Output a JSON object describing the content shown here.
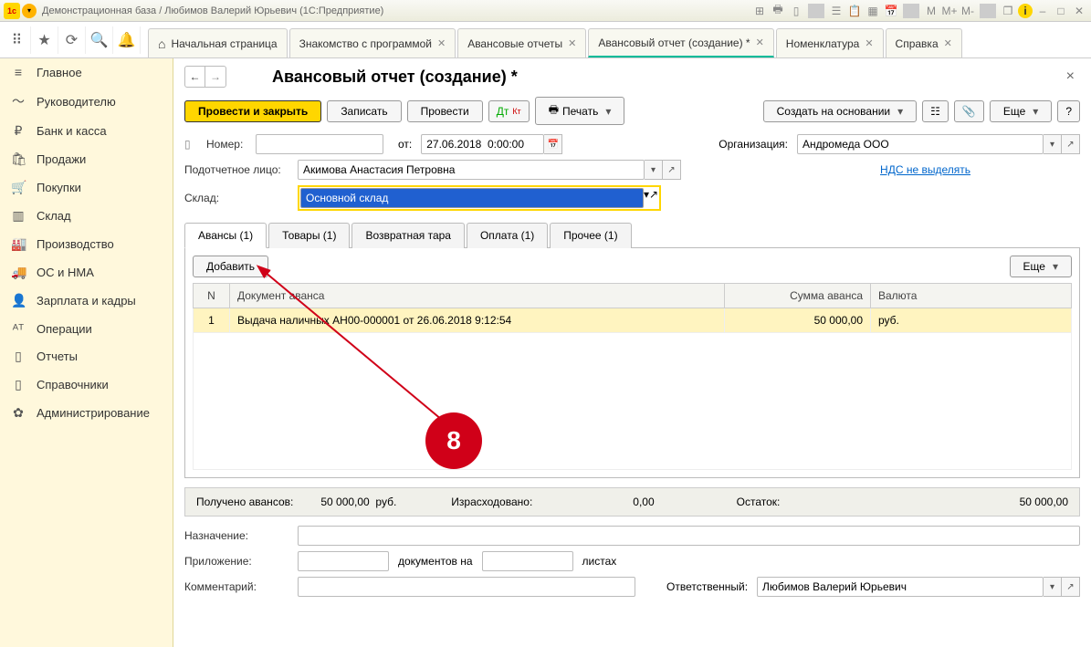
{
  "titlebar": {
    "title": "Демонстрационная база / Любимов Валерий Юрьевич  (1С:Предприятие)"
  },
  "tabs": {
    "home": "Начальная страница",
    "t1": "Знакомство с программой",
    "t2": "Авансовые отчеты",
    "t3": "Авансовый отчет (создание) *",
    "t4": "Номенклатура",
    "t5": "Справка"
  },
  "sidebar": {
    "items": [
      {
        "icon": "≡",
        "label": "Главное"
      },
      {
        "icon": "〜",
        "label": "Руководителю"
      },
      {
        "icon": "₽",
        "label": "Банк и касса"
      },
      {
        "icon": "🛍",
        "label": "Продажи"
      },
      {
        "icon": "🛒",
        "label": "Покупки"
      },
      {
        "icon": "▥",
        "label": "Склад"
      },
      {
        "icon": "🏭",
        "label": "Производство"
      },
      {
        "icon": "🚚",
        "label": "ОС и НМА"
      },
      {
        "icon": "👤",
        "label": "Зарплата и кадры"
      },
      {
        "icon": "ᴬᵀ",
        "label": "Операции"
      },
      {
        "icon": "▯",
        "label": "Отчеты"
      },
      {
        "icon": "▯",
        "label": "Справочники"
      },
      {
        "icon": "✿",
        "label": "Администрирование"
      }
    ]
  },
  "page": {
    "title": "Авансовый отчет (создание) *",
    "buttons": {
      "post_close": "Провести и закрыть",
      "save": "Записать",
      "post": "Провести",
      "print": "Печать",
      "create_based": "Создать на основании",
      "more": "Еще"
    },
    "form": {
      "number_label": "Номер:",
      "from_label": "от:",
      "date": "27.06.2018  0:00:00",
      "org_label": "Организация:",
      "org": "Андромеда ООО",
      "person_label": "Подотчетное лицо:",
      "person": "Акимова Анастасия Петровна",
      "vat_link": "НДС не выделять",
      "warehouse_label": "Склад:",
      "warehouse": "Основной склад"
    },
    "doc_tabs": {
      "t1": "Авансы (1)",
      "t2": "Товары (1)",
      "t3": "Возвратная тара",
      "t4": "Оплата (1)",
      "t5": "Прочее (1)"
    },
    "tablebar": {
      "add": "Добавить",
      "more": "Еще"
    },
    "table": {
      "h_n": "N",
      "h_doc": "Документ аванса",
      "h_sum": "Сумма аванса",
      "h_cur": "Валюта",
      "r1_n": "1",
      "r1_doc": "Выдача наличных АН00-000001 от 26.06.2018 9:12:54",
      "r1_sum": "50 000,00",
      "r1_cur": "руб."
    },
    "summary": {
      "received_label": "Получено авансов:",
      "received": "50 000,00",
      "received_cur": "руб.",
      "spent_label": "Израсходовано:",
      "spent": "0,00",
      "rest_label": "Остаток:",
      "rest": "50 000,00"
    },
    "bottom": {
      "purpose_label": "Назначение:",
      "attach_label": "Приложение:",
      "docs_on": "документов на",
      "sheets": "листах",
      "comment_label": "Комментарий:",
      "resp_label": "Ответственный:",
      "resp": "Любимов Валерий Юрьевич"
    }
  },
  "annotation": {
    "number": "8"
  }
}
